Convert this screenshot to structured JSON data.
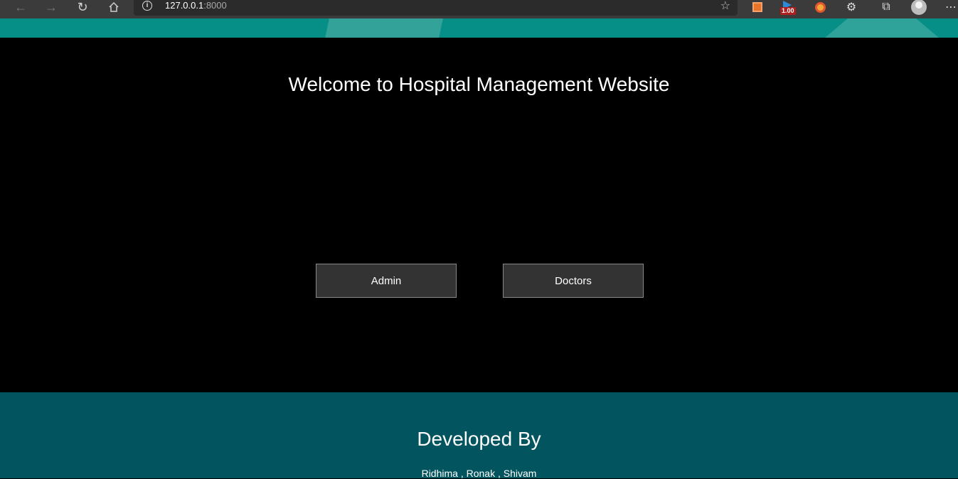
{
  "browser": {
    "url_host": "127.0.0.1",
    "url_port": ":8000",
    "extension_badge": "1.00",
    "icons": {
      "back": "back-arrow-icon",
      "forward": "forward-arrow-icon",
      "refresh": "refresh-icon",
      "home": "home-icon",
      "info": "info-icon",
      "favorite": "favorite-star-icon",
      "collections": "collections-icon",
      "extensions": "extensions-puzzle-icon",
      "profile": "profile-avatar-icon",
      "menu": "more-menu-icon"
    }
  },
  "page": {
    "title": "Welcome to Hospital Management Website",
    "buttons": {
      "admin": "Admin",
      "doctors": "Doctors"
    }
  },
  "footer": {
    "title": "Developed By",
    "names": "Ridhima , Ronak , Shivam"
  },
  "colors": {
    "toolbar": "#3b3b3b",
    "strip": "#068f86",
    "main_bg": "#000000",
    "button_bg": "#333333",
    "footer_bg": "#02545e"
  }
}
